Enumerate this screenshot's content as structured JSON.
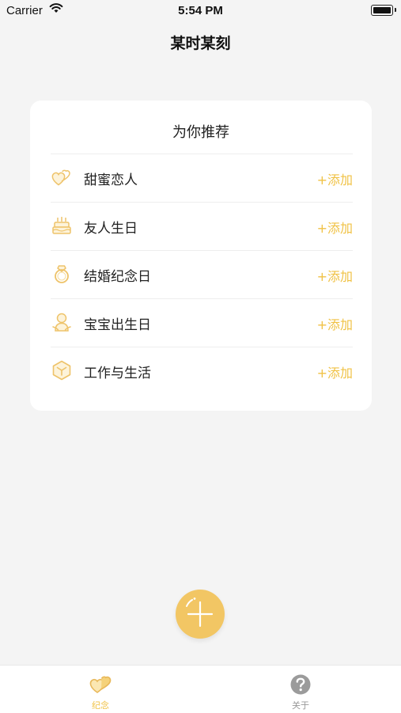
{
  "status_bar": {
    "carrier": "Carrier",
    "time": "5:54 PM"
  },
  "nav": {
    "title": "某时某刻"
  },
  "card": {
    "title": "为你推荐",
    "items": [
      {
        "label": "甜蜜恋人",
        "action": "+添加",
        "icon": "hearts-icon"
      },
      {
        "label": "友人生日",
        "action": "+添加",
        "icon": "cake-icon"
      },
      {
        "label": "结婚纪念日",
        "action": "+添加",
        "icon": "ring-icon"
      },
      {
        "label": "宝宝出生日",
        "action": "+添加",
        "icon": "baby-icon"
      },
      {
        "label": "工作与生活",
        "action": "+添加",
        "icon": "cube-icon"
      }
    ]
  },
  "fab": {
    "icon": "plus-icon"
  },
  "tabs": [
    {
      "label": "纪念",
      "icon": "hearts-icon",
      "active": true
    },
    {
      "label": "关于",
      "icon": "question-icon",
      "active": false
    }
  ],
  "colors": {
    "accent": "#f0c245",
    "fab": "#f2c664",
    "background": "#f4f4f4",
    "inactive": "#999999"
  }
}
